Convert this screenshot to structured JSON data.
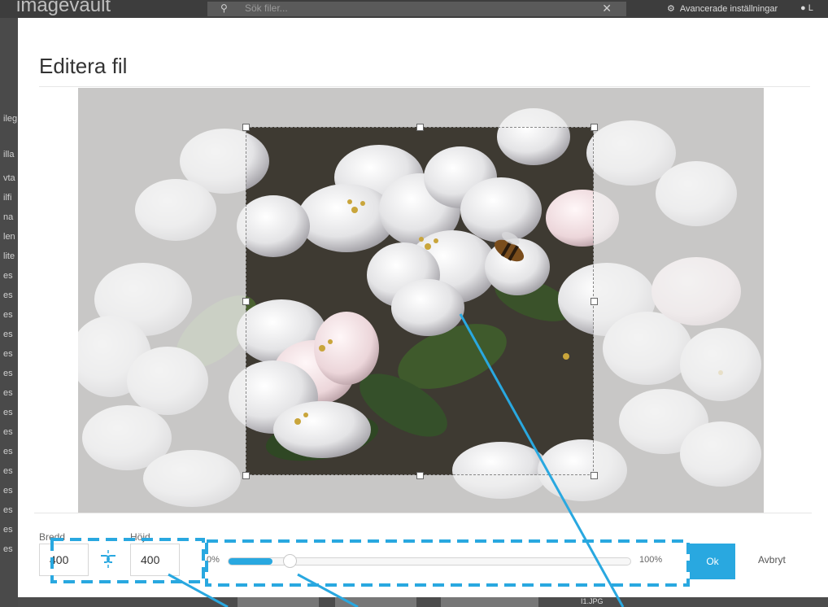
{
  "background_app": {
    "logo": "imagevault",
    "search_placeholder": "Sök filer...",
    "advanced_settings": "Avancerade inställningar",
    "user_initial": "L",
    "sidebar_fragments": [
      "ileg",
      "illa",
      "vta",
      "ilfi",
      "na",
      "len",
      "lite",
      "es",
      "es",
      "es",
      "es",
      "es",
      "es",
      "es",
      "es",
      "es",
      "es",
      "es",
      "es",
      "es",
      "es",
      "es"
    ],
    "bottom_filename": "I1.JPG"
  },
  "modal": {
    "title": "Editera fil",
    "width_label": "Bredd",
    "width_value": "400",
    "height_label": "Höjd",
    "height_value": "400",
    "zoom_min_label": "0%",
    "zoom_max_label": "100%",
    "zoom_value_percent": 11,
    "ok_label": "Ok",
    "cancel_label": "Avbryt"
  },
  "icons": {
    "link": "link-aspect-ratio-icon",
    "search": "search-icon",
    "clear": "close-icon",
    "settings": "gear-icon",
    "user": "user-icon"
  },
  "colors": {
    "accent": "#29a8e0",
    "annotation": "#29a8e0",
    "title_text": "#333333",
    "topbar": "#3d3d3d"
  }
}
